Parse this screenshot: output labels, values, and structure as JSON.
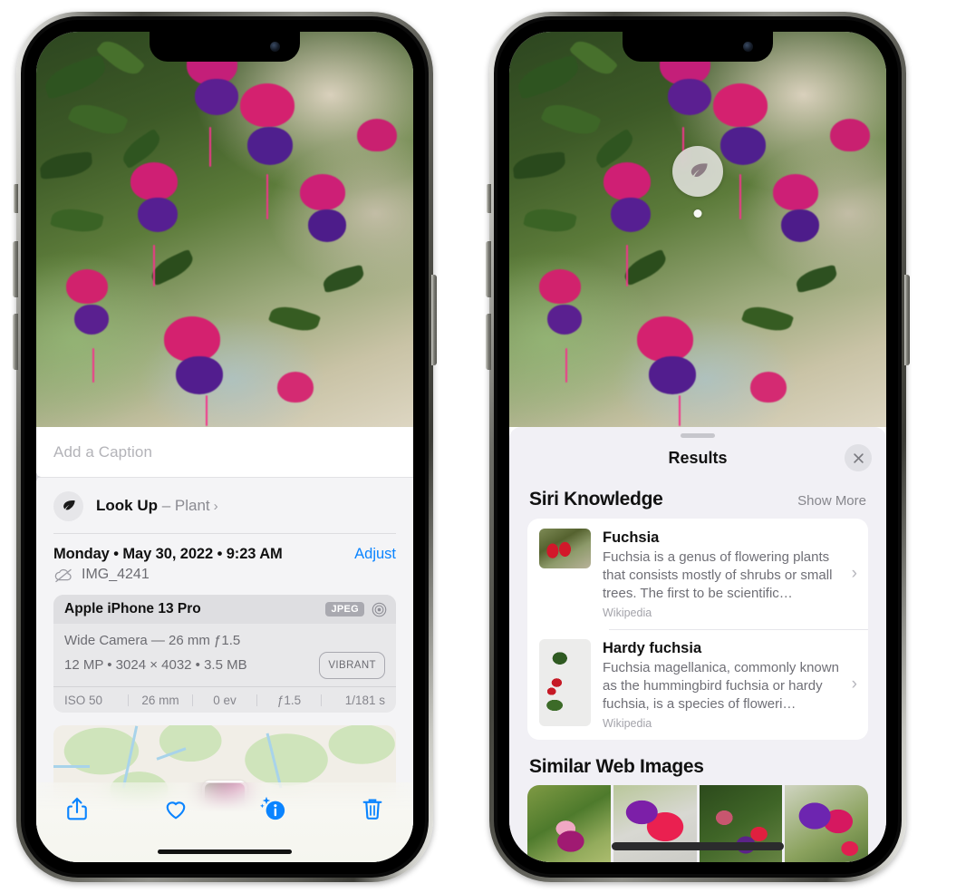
{
  "left_phone": {
    "caption": {
      "placeholder": "Add a Caption",
      "value": ""
    },
    "lookup": {
      "label": "Look Up",
      "dash": " – ",
      "subject": "Plant",
      "chevron": "›",
      "icon": "leaf-icon"
    },
    "date_row": {
      "date": "Monday • May 30, 2022 • 9:23 AM",
      "adjust": "Adjust"
    },
    "file_row": {
      "filename": "IMG_4241",
      "icon": "cloud-slash-icon"
    },
    "meta_card": {
      "device": "Apple iPhone 13 Pro",
      "format_badge": "JPEG",
      "lens_icon": "lens-icon",
      "lens_line": "Wide Camera — 26 mm ƒ1.5",
      "size_line": "12 MP • 3024 × 4032 • 3.5 MB",
      "style_badge": "VIBRANT",
      "exif": [
        "ISO 50",
        "26 mm",
        "0 ev",
        "ƒ1.5",
        "1/181 s"
      ]
    },
    "toolbar": [
      {
        "name": "share-icon",
        "label": "Share"
      },
      {
        "name": "heart-icon",
        "label": "Favorite"
      },
      {
        "name": "info-sparkle-icon",
        "label": "Info"
      },
      {
        "name": "trash-icon",
        "label": "Delete"
      }
    ]
  },
  "right_phone": {
    "vlu_badge": {
      "icon": "leaf-icon"
    },
    "sheet": {
      "title": "Results",
      "close_icon": "close-icon",
      "grabber": "drag-handle"
    },
    "siri_knowledge": {
      "title": "Siri Knowledge",
      "show_more": "Show More",
      "items": [
        {
          "title": "Fuchsia",
          "description": "Fuchsia is a genus of flowering plants that consists mostly of shrubs or small trees. The first to be scientific…",
          "source": "Wikipedia",
          "chevron": "›"
        },
        {
          "title": "Hardy fuchsia",
          "description": "Fuchsia magellanica, commonly known as the hummingbird fuchsia or hardy fuchsia, is a species of floweri…",
          "source": "Wikipedia",
          "chevron": "›"
        }
      ]
    },
    "similar_web_images": {
      "title": "Similar Web Images",
      "thumbs": [
        "web-image-1",
        "web-image-2",
        "web-image-3",
        "web-image-4"
      ]
    }
  },
  "colors": {
    "accent_blue": "#0a84ff",
    "sheet_bg": "#f1f0f5",
    "card_bg": "#ffffff",
    "meta_card_bg": "#e8e8ea",
    "secondary_text": "#6c6c72"
  }
}
